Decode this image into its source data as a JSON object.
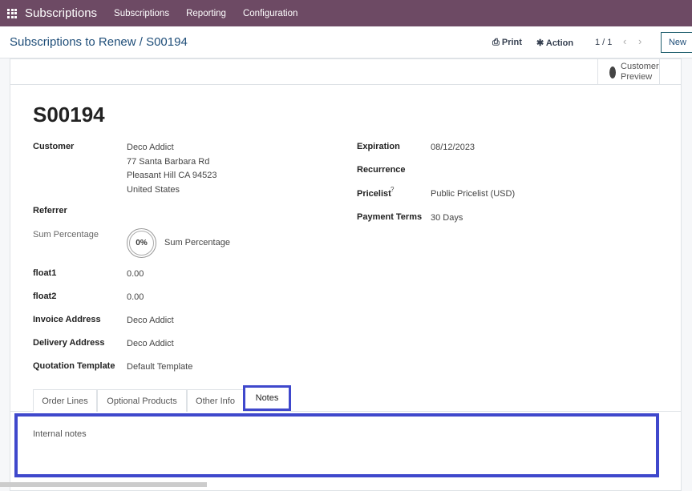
{
  "navbar": {
    "app": "Subscriptions",
    "menu": [
      "Subscriptions",
      "Reporting",
      "Configuration"
    ],
    "color": "#6d4a64"
  },
  "control": {
    "breadcrumb": "Subscriptions to Renew / S00194",
    "print": "Print",
    "action": "Action",
    "pager": "1 / 1",
    "new": "New"
  },
  "button_box": {
    "customer_preview": "Customer Preview"
  },
  "record": {
    "title": "S00194",
    "left": {
      "customer_label": "Customer",
      "customer_lines": [
        "Deco Addict",
        "77 Santa Barbara Rd",
        "Pleasant Hill CA 94523",
        "United States"
      ],
      "referrer_label": "Referrer",
      "sum_label": "Sum Percentage",
      "sum_value": "0%",
      "sum_text": "Sum Percentage",
      "float1_label": "float1",
      "float1": "0.00",
      "float2_label": "float2",
      "float2": "0.00",
      "invoice_label": "Invoice Address",
      "invoice": "Deco Addict",
      "delivery_label": "Delivery Address",
      "delivery": "Deco Addict",
      "template_label": "Quotation Template",
      "template": "Default Template"
    },
    "right": {
      "expiration_label": "Expiration",
      "expiration": "08/12/2023",
      "recurrence_label": "Recurrence",
      "pricelist_label": "Pricelist",
      "pricelist_help": "?",
      "pricelist": "Public Pricelist (USD)",
      "terms_label": "Payment Terms",
      "terms": "30 Days"
    }
  },
  "tabs": [
    "Order Lines",
    "Optional Products",
    "Other Info",
    "Notes"
  ],
  "active_tab": "Notes",
  "notes": {
    "placeholder": "Internal notes"
  },
  "highlight_color": "#3f48cc"
}
